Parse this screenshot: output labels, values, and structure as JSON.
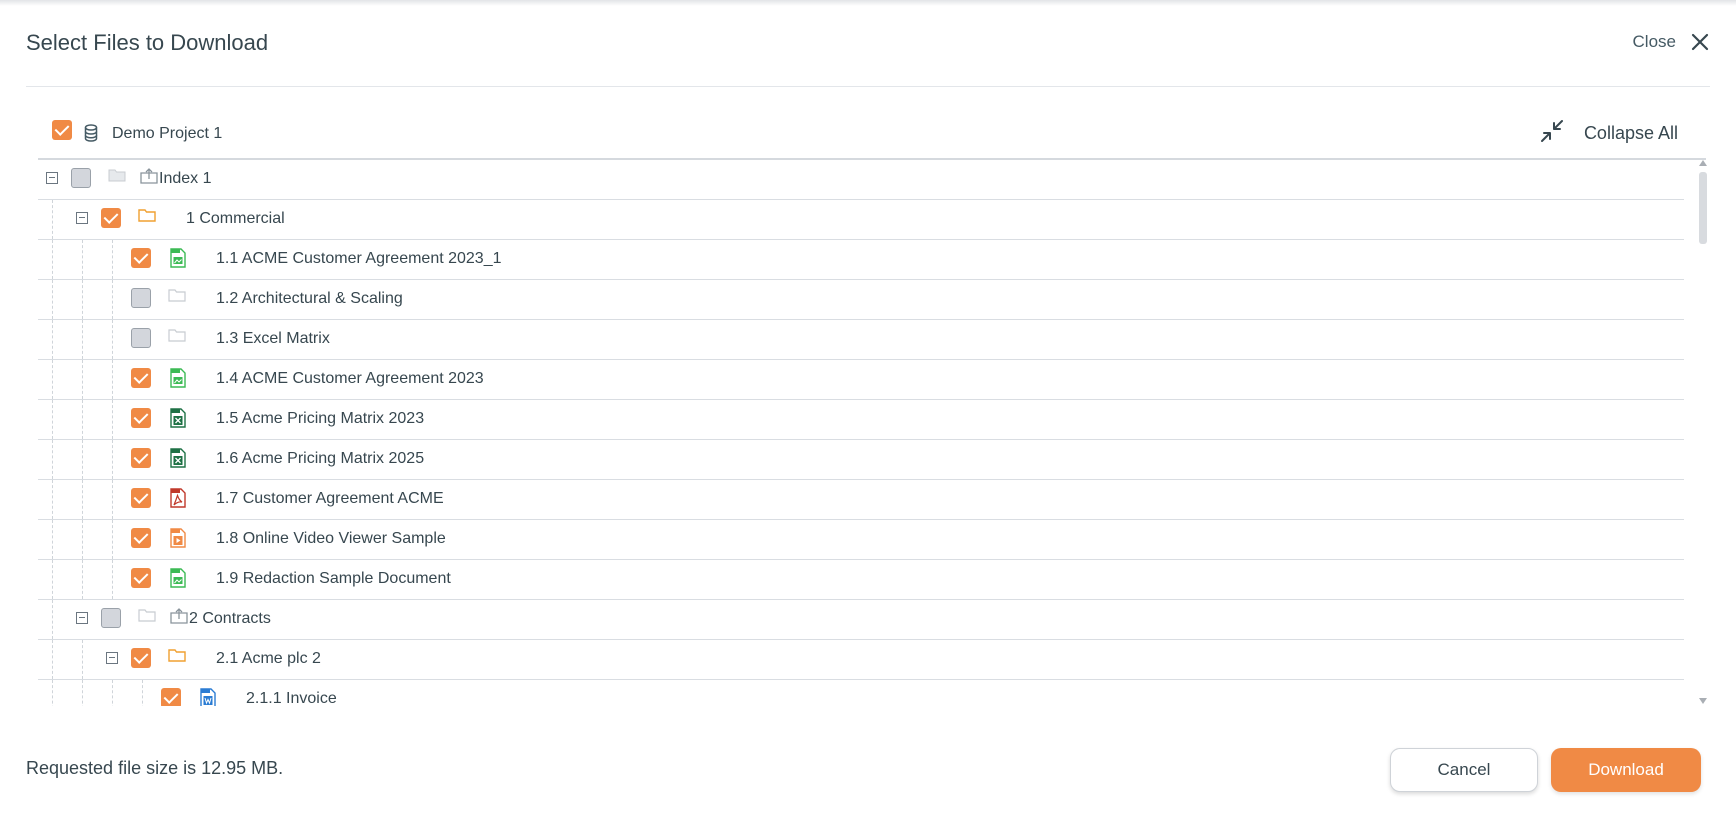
{
  "dialog": {
    "title": "Select Files to Download",
    "close_label": "Close"
  },
  "project": {
    "name": "Demo Project 1",
    "checked": true,
    "collapse_all_label": "Collapse All"
  },
  "tree": {
    "rows": [
      {
        "label": "Index 1",
        "checked": false,
        "type": "index",
        "expanded": true
      },
      {
        "label": "1 Commercial",
        "checked": true,
        "type": "folder",
        "expanded": true
      },
      {
        "label": "1.1 ACME Customer Agreement 2023_1",
        "checked": true,
        "type": "image"
      },
      {
        "label": "1.2 Architectural & Scaling",
        "checked": false,
        "type": "empty-folder"
      },
      {
        "label": "1.3 Excel Matrix",
        "checked": false,
        "type": "empty-folder"
      },
      {
        "label": "1.4 ACME Customer Agreement 2023",
        "checked": true,
        "type": "image"
      },
      {
        "label": "1.5 Acme Pricing Matrix 2023",
        "checked": true,
        "type": "excel"
      },
      {
        "label": "1.6 Acme Pricing Matrix 2025",
        "checked": true,
        "type": "excel"
      },
      {
        "label": "1.7 Customer Agreement ACME",
        "checked": true,
        "type": "pdf"
      },
      {
        "label": "1.8 Online Video Viewer Sample",
        "checked": true,
        "type": "video"
      },
      {
        "label": "1.9 Redaction Sample Document",
        "checked": true,
        "type": "image"
      },
      {
        "label": "2 Contracts",
        "checked": false,
        "type": "index",
        "expanded": true
      },
      {
        "label": "2.1 Acme plc 2",
        "checked": true,
        "type": "folder",
        "expanded": true
      },
      {
        "label": "2.1.1 Invoice",
        "checked": true,
        "type": "word"
      }
    ]
  },
  "footer": {
    "size_text": "Requested file size is 12.95 MB.",
    "cancel_label": "Cancel",
    "download_label": "Download"
  },
  "colors": {
    "accent": "#f08a45",
    "text": "#37474f",
    "excel": "#1e7145",
    "image": "#3cba54",
    "pdf": "#c0392b",
    "video": "#f08a45",
    "word": "#2b7cd3",
    "folder": "#f0a030"
  },
  "icons": {
    "project": "database-icon",
    "collapse": "collapse-arrows-icon",
    "close": "close-x-icon"
  }
}
